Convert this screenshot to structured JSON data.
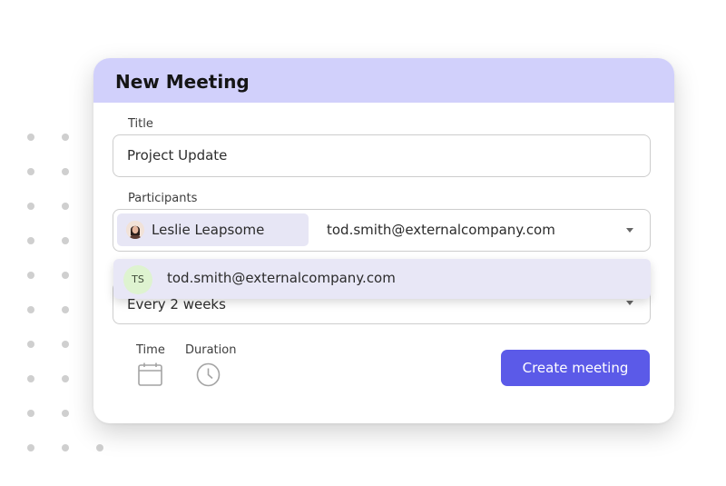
{
  "dialog": {
    "title": "New Meeting",
    "header_color": "#d1d0fb"
  },
  "title_field": {
    "label": "Title",
    "value": "Project Update"
  },
  "participants_field": {
    "label": "Participants",
    "selected_chip": {
      "name": "Leslie Leapsome",
      "icon": "avatar-photo"
    },
    "typed_value": "tod.smith@externalcompany.com"
  },
  "suggestion": {
    "initials": "TS",
    "email": "tod.smith@externalcompany.com"
  },
  "repeat_field": {
    "value": "Every 2 weeks"
  },
  "time": {
    "label": "Time",
    "icon": "calendar-icon"
  },
  "duration": {
    "label": "Duration",
    "icon": "clock-icon"
  },
  "actions": {
    "create_label": "Create meeting",
    "accent_color": "#5b5ae8"
  }
}
